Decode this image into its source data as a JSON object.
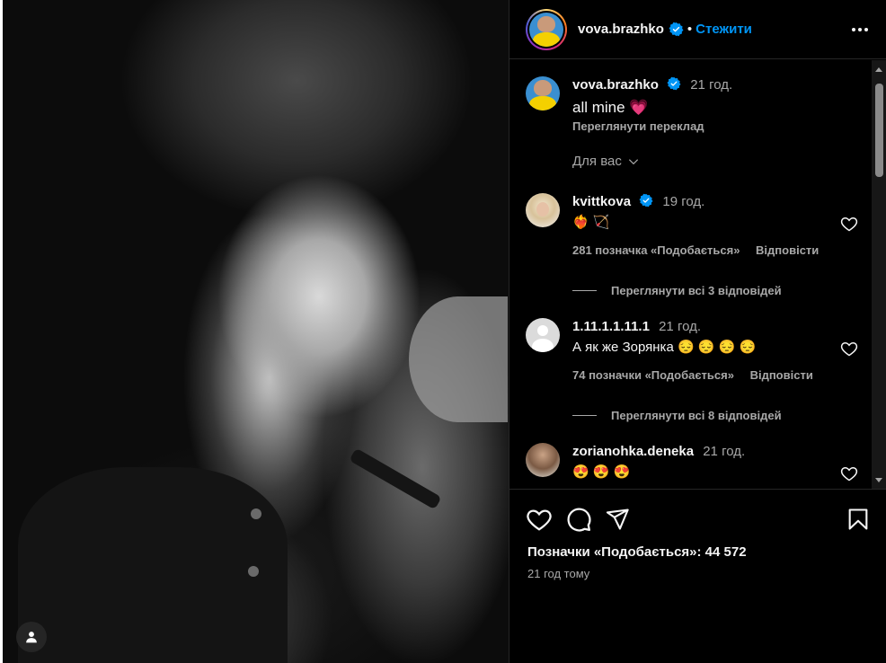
{
  "post": {
    "author": "vova.brazhko",
    "separator": "•",
    "follow_label": "Стежити",
    "caption_time": "21 год.",
    "caption_text": "all mine",
    "caption_emoji": "💗",
    "translate_label": "Переглянути переклад",
    "likes_text": "Позначки «Подобається»: 44 572",
    "time_ago": "21 год тому"
  },
  "filter": {
    "label": "Для вас"
  },
  "comments": [
    {
      "user": "kvittkova",
      "verified": true,
      "time": "19 год.",
      "text": "❤️‍🔥 🏹",
      "likes": "281 позначка «Подобається»",
      "reply_label": "Відповісти",
      "view_replies": "Переглянути всі 3 відповідей"
    },
    {
      "user": "1.11.1.1.11.1",
      "verified": false,
      "time": "21 год.",
      "text": "А як же Зорянка 😔 😔 😔 😔",
      "likes": "74 позначки «Подобається»",
      "reply_label": "Відповісти",
      "view_replies": "Переглянути всі 8 відповідей"
    },
    {
      "user": "zorianohka.deneka",
      "verified": false,
      "time": "21 год.",
      "text": "😍 😍 😍"
    }
  ],
  "icons": {
    "like": "heart-icon",
    "comment": "comment-icon",
    "share": "send-icon",
    "save": "bookmark-icon",
    "verified": "verified-badge-icon",
    "more": "more-options-icon",
    "tagged": "user-tag-icon"
  },
  "colors": {
    "background": "#000000",
    "link_blue": "#0095f6",
    "secondary_text": "#a8a8a8",
    "verified_blue": "#0095f6"
  }
}
